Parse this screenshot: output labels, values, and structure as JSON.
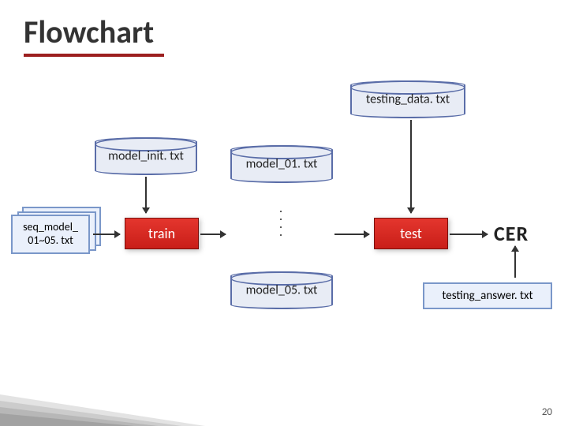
{
  "title": "Flowchart",
  "nodes": {
    "testing_data": "testing_data. txt",
    "model_init": "model_init. txt",
    "model_01": "model_01. txt",
    "model_05": "model_05. txt",
    "seq_model": "seq_model_\n01~05. txt",
    "train": "train",
    "test": "test",
    "cer": "CER",
    "testing_answer": "testing_answer. txt"
  },
  "dots": ".\n.\n.\n.",
  "page_number": "20",
  "colors": {
    "accent": "#9c1f1f",
    "cylinder_border": "#5a6da8",
    "cylinder_fill": "#e8ecf5",
    "process": "#c91e18",
    "file_border": "#7a97c9",
    "file_fill": "#eaf0fb"
  },
  "chart_data": {
    "type": "diagram",
    "title": "Flowchart",
    "nodes": [
      {
        "id": "testing_data",
        "label": "testing_data.txt",
        "shape": "cylinder"
      },
      {
        "id": "model_init",
        "label": "model_init.txt",
        "shape": "cylinder"
      },
      {
        "id": "model_01",
        "label": "model_01.txt",
        "shape": "cylinder"
      },
      {
        "id": "model_05",
        "label": "model_05.txt",
        "shape": "cylinder"
      },
      {
        "id": "seq_model",
        "label": "seq_model_01~05.txt",
        "shape": "stacked-box"
      },
      {
        "id": "train",
        "label": "train",
        "shape": "process"
      },
      {
        "id": "test",
        "label": "test",
        "shape": "process"
      },
      {
        "id": "cer",
        "label": "CER",
        "shape": "text"
      },
      {
        "id": "testing_answer",
        "label": "testing_answer.txt",
        "shape": "box"
      },
      {
        "id": "ellipsis",
        "label": "...",
        "shape": "text"
      }
    ],
    "edges": [
      {
        "from": "model_init",
        "to": "train"
      },
      {
        "from": "seq_model",
        "to": "train"
      },
      {
        "from": "train",
        "to": "model_01"
      },
      {
        "from": "model_01",
        "to": "ellipsis"
      },
      {
        "from": "ellipsis",
        "to": "model_05"
      },
      {
        "from": "model_05",
        "to": "test"
      },
      {
        "from": "testing_data",
        "to": "test"
      },
      {
        "from": "test",
        "to": "cer"
      },
      {
        "from": "testing_answer",
        "to": "cer"
      }
    ]
  }
}
